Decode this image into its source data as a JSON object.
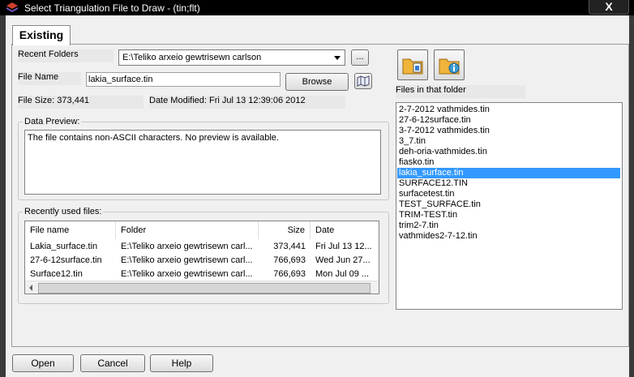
{
  "window": {
    "title": "Select Triangulation File to Draw - (tin;flt)",
    "close_label": "X"
  },
  "tabs": [
    {
      "label": "Existing"
    }
  ],
  "recent_folders": {
    "label": "Recent Folders",
    "value": "E:\\Teliko arxeio gewtrisewn carlson",
    "browse_label": "..."
  },
  "file_name": {
    "label": "File Name",
    "value": "lakia_surface.tin",
    "browse_label": "Browse"
  },
  "file_info": {
    "size": "File Size: 373,441",
    "modified": "Date Modified: Fri Jul 13 12:39:06 2012"
  },
  "data_preview": {
    "title": "Data Preview:",
    "text": "The file contains non-ASCII characters. No preview is available."
  },
  "recent_files": {
    "title": "Recently used files:",
    "columns": [
      "File name",
      "Folder",
      "Size",
      "Date"
    ],
    "rows": [
      [
        "Lakia_surface.tin",
        "E:\\Teliko arxeio gewtrisewn carl...",
        "373,441",
        "Fri Jul 13 12..."
      ],
      [
        "27-6-12surface.tin",
        "E:\\Teliko arxeio gewtrisewn carl...",
        "766,693",
        "Wed Jun 27..."
      ],
      [
        "Surface12.tin",
        "E:\\Teliko arxeio gewtrisewn carl...",
        "766,693",
        "Mon Jul 09 ..."
      ]
    ]
  },
  "folder_files": {
    "label": "Files in that folder",
    "items": [
      "2-7-2012 vathmides.tin",
      "27-6-12surface.tin",
      "3-7-2012 vathmides.tin",
      "3_7.tin",
      "deh-oria-vathmides.tin",
      "fiasko.tin",
      "lakia_surface.tin",
      "SURFACE12.TIN",
      "surfacetest.tin",
      "TEST_SURFACE.tin",
      "TRIM-TEST.tin",
      "trim2-7.tin",
      "vathmides2-7-12.tin"
    ],
    "selected": "lakia_surface.tin"
  },
  "buttons": {
    "open": "Open",
    "cancel": "Cancel",
    "help": "Help"
  },
  "icons": [
    "app-icon",
    "folder-open-icon",
    "folder-info-icon",
    "map-icon",
    "dropdown-arrow-icon"
  ]
}
